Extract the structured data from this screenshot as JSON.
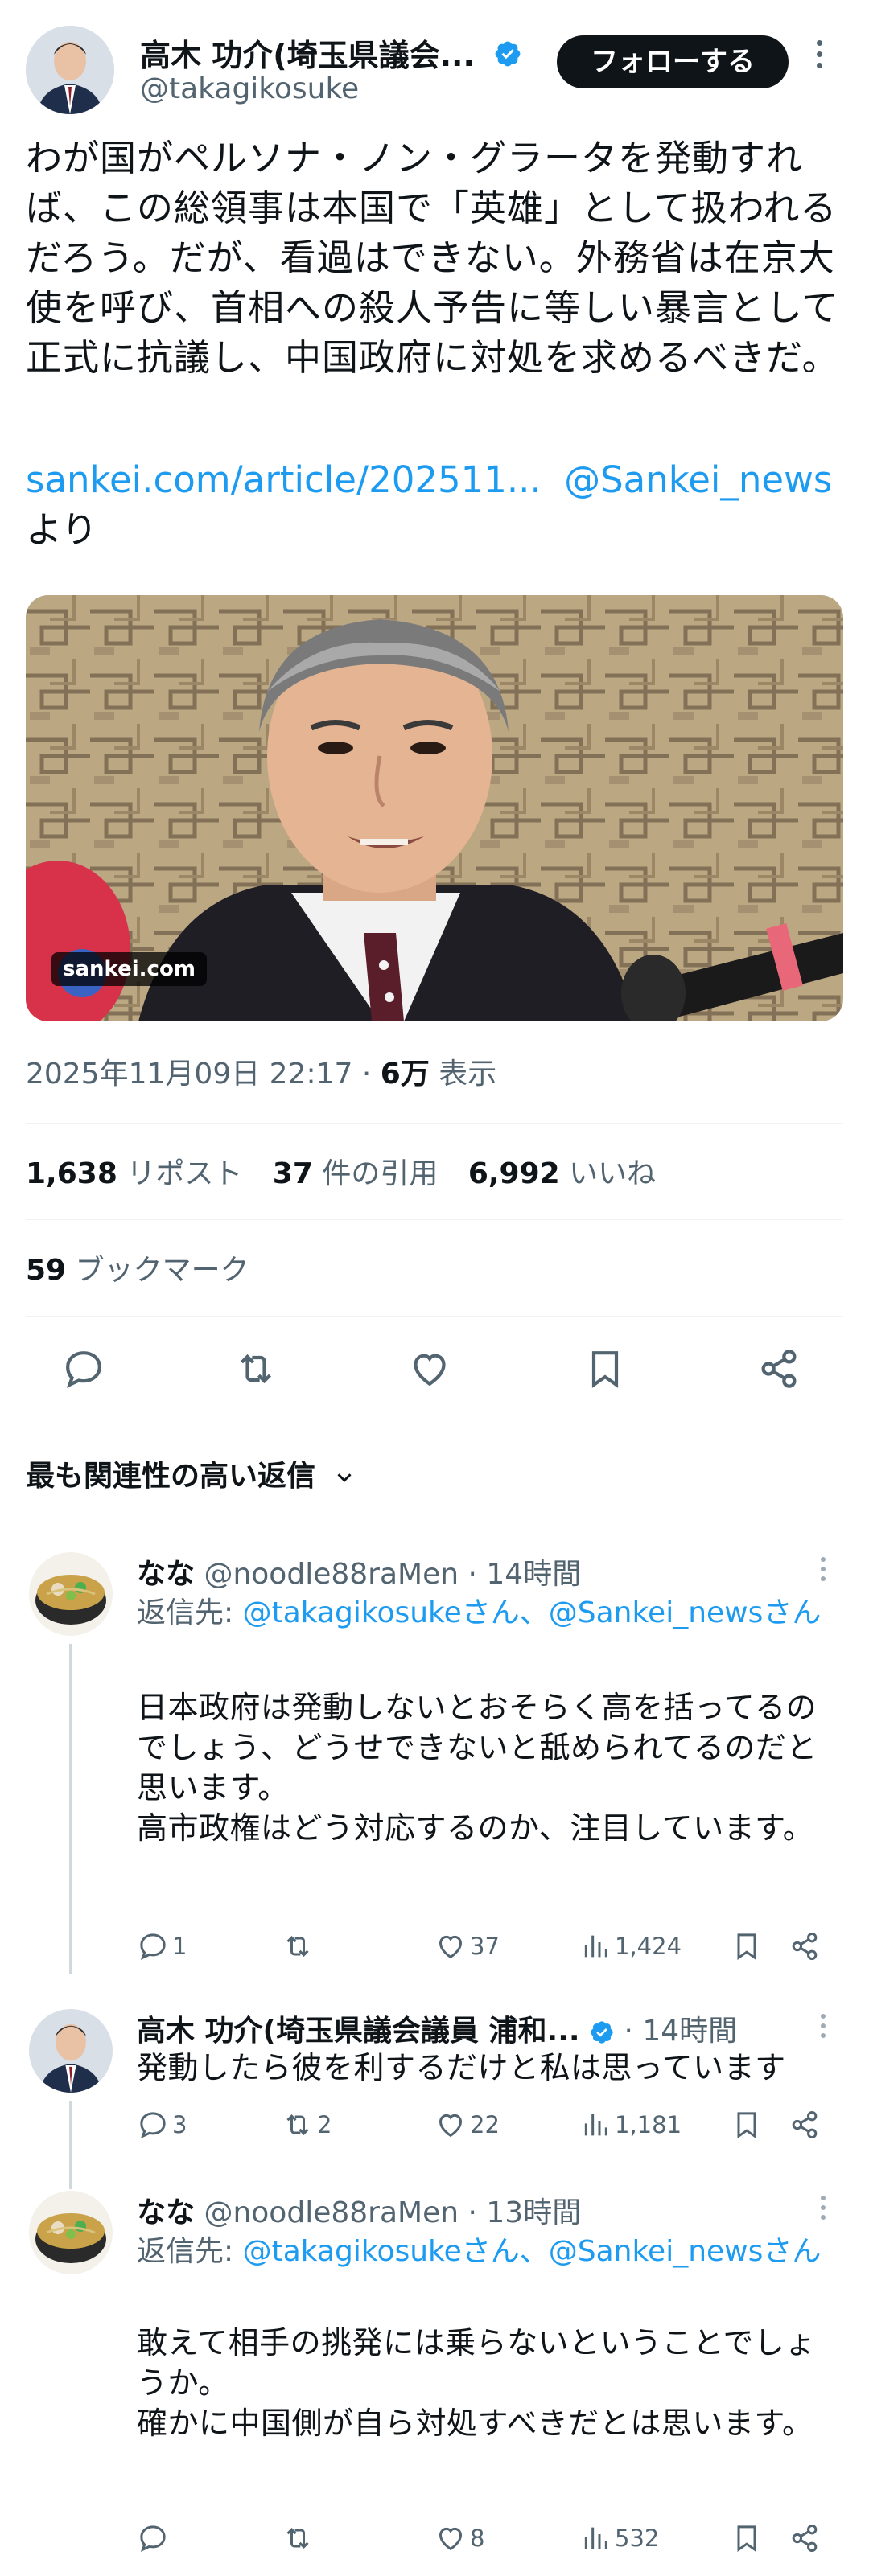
{
  "tweet": {
    "display_name": "高木 功介(埼玉県議会...",
    "handle": "@takagikosuke",
    "follow_label": "フォローする",
    "text": "わが国がペルソナ・ノン・グラータを発動すれば、この総領事は本国で「英雄」として扱われるだろう。だが、看過はできない。外務省は在京大使を呼び、首相への殺人予告に等しい暴言として正式に抗議し、中国政府に対処を求めるべきだ。",
    "link": "sankei.com/article/202511...",
    "mention": "@Sankei_news",
    "link_suffix": "より",
    "media_badge": "sankei.com",
    "timestamp": "2025年11月09日 22:17",
    "views_value": "6万",
    "views_label": "表示",
    "reposts_value": "1,638",
    "reposts_label": "リポスト",
    "quotes_value": "37",
    "quotes_label": "件の引用",
    "likes_value": "6,992",
    "likes_label": "いいね",
    "bookmarks_value": "59",
    "bookmarks_label": "ブックマーク"
  },
  "replies_section": {
    "title": "最も関連性の高い返信"
  },
  "replies": [
    {
      "name": "なな",
      "handle": "@noodle88raMen",
      "time": "· 14時間",
      "replying_prefix": "返信先: ",
      "replying_to": "@takagikosukeさん、@Sankei_newsさん",
      "body": "日本政府は発動しないとおそらく高を括ってるのでしょう、どうせできないと舐められてるのだと思います。\n高市政権はどう対応するのか、注目しています。",
      "replies": "1",
      "reposts": "",
      "likes": "37",
      "views": "1,424"
    },
    {
      "name": "高木 功介(埼玉県議会議員 浦和...",
      "time": "· 14時間",
      "body": "発動したら彼を利するだけと私は思っています",
      "replies": "3",
      "reposts": "2",
      "likes": "22",
      "views": "1,181"
    },
    {
      "name": "なな",
      "handle": "@noodle88raMen",
      "time": "· 13時間",
      "replying_prefix": "返信先: ",
      "replying_to": "@takagikosukeさん、@Sankei_newsさん",
      "body": "敢えて相手の挑発には乗らないということでしょうか。\n確かに中国側が自ら対処すべきだとは思います。",
      "replies": "",
      "reposts": "",
      "likes": "8",
      "views": "532"
    }
  ],
  "colors": {
    "link": "#1d9bf0",
    "muted": "#536471",
    "verified": "#1d9bf0"
  }
}
